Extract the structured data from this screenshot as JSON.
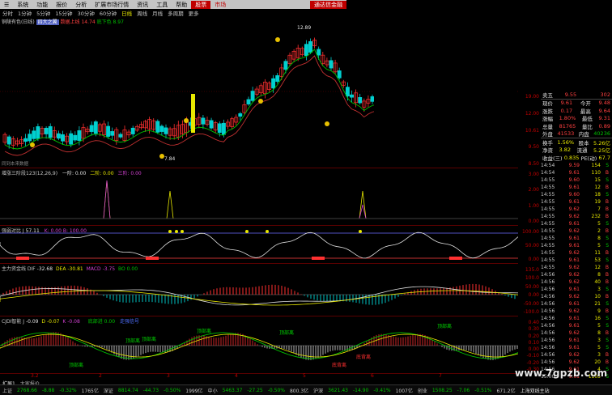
{
  "menu": {
    "items": [
      "系统",
      "功能",
      "报价",
      "分析",
      "扩展市场行情",
      "资讯",
      "工具",
      "帮助"
    ],
    "active_tab": "股票",
    "tab2": "市场",
    "right_button": "通达信金融"
  },
  "periods": [
    "分时",
    "1分钟",
    "5分钟",
    "15分钟",
    "30分钟",
    "60分钟",
    "日线",
    "周线",
    "月线",
    "多周期",
    "更多"
  ],
  "main_panel": {
    "title": "铜陵有色(日线)",
    "tag1": "四大之翼",
    "tag2": "数据上线",
    "tag2_value": "14.74",
    "tag3": "底下色",
    "tag3_value": "8.97",
    "high_label": "12.89",
    "low_label": "7.84",
    "footer_label": "同到本来数据",
    "axis": [
      "19.00",
      "12.00",
      "10.61",
      "9.50",
      "8.50"
    ]
  },
  "panel1": {
    "title": "增涨三阶段123(12,26,9)",
    "v1_label": "一阶:",
    "v1": "0.00",
    "v2_label": "二阶:",
    "v2": "0.00",
    "v3_label": "三阶:",
    "v3": "0.00",
    "axis": [
      "3.00",
      "2.00",
      "1.00",
      "0.00"
    ]
  },
  "panel2": {
    "title": "强弱对比 J",
    "value": "57.11",
    "extra": "K: 0.00 B: 100.00",
    "axis": [
      "100.00",
      "50.00",
      "0.00"
    ]
  },
  "panel3": {
    "title": "主力资金线 DIF",
    "dif": "-32.68",
    "dea_label": "DEA",
    "dea": "-30.81",
    "macd_label": "MACD",
    "macd": "-3.75",
    "bo_label": "BO",
    "bo": "0.00",
    "axis": [
      "135.0",
      "100.0",
      "50.00",
      "0.00",
      "-50.00",
      "-100.0"
    ]
  },
  "panel4": {
    "title": "CJDI智能 J",
    "j": "-0.09",
    "d_label": "D",
    "d": "-0.07",
    "k_label": "K",
    "k": "-0.08",
    "tag": "底部进",
    "tag_value": "0.00",
    "tag2": "走强信号",
    "annotations": [
      "顶部离",
      "顶部离",
      "顶部离",
      "顶部离",
      "顶部离",
      "顶部离",
      "底背离",
      "底背离"
    ],
    "axis": [
      "0.40",
      "0.30",
      "0.20",
      "0.10",
      "0.00",
      "-0.10",
      "-0.20",
      "-0.30"
    ]
  },
  "date_labels": [
    "3.2",
    "2",
    "3",
    "4",
    "5",
    "6",
    "7"
  ],
  "tabs": [
    "扩展1",
    "大家报价"
  ],
  "quote": {
    "rows": [
      {
        "l": "卖五",
        "v": "9.55",
        "r": "",
        "rv": "302"
      },
      {
        "l": "现价",
        "v": "9.61",
        "r": "今开",
        "rv": "9.48"
      },
      {
        "l": "涨跌",
        "v": "0.17",
        "r": "最高",
        "rv": "9.64"
      },
      {
        "l": "涨幅",
        "v": "1.80%",
        "r": "最低",
        "rv": "9.31"
      },
      {
        "l": "总量",
        "v": "81765",
        "r": "量比",
        "rv": "0.89"
      },
      {
        "l": "外盘",
        "v": "41533",
        "r": "内盘",
        "rv": "40236"
      },
      {
        "l": "换手",
        "v": "1.56%",
        "r": "股本",
        "rv": "5.26亿"
      },
      {
        "l": "净资",
        "v": "3.82",
        "r": "流通",
        "rv": "5.25亿"
      },
      {
        "l": "收益(三)",
        "v": "0.835",
        "r": "PE(动)",
        "rv": "67.7"
      }
    ],
    "colors": {
      "red": "#ff4040",
      "green": "#00c000",
      "yellow": "#e8e800",
      "white": "#e0e0e0"
    }
  },
  "ticks": [
    {
      "t": "14:54",
      "p": "9.59",
      "v": "154",
      "s": "S"
    },
    {
      "t": "14:54",
      "p": "9.61",
      "v": "110",
      "s": "B"
    },
    {
      "t": "14:55",
      "p": "9.60",
      "v": "15",
      "s": "S"
    },
    {
      "t": "14:55",
      "p": "9.61",
      "v": "12",
      "s": "B"
    },
    {
      "t": "14:55",
      "p": "9.60",
      "v": "18",
      "s": "S"
    },
    {
      "t": "14:55",
      "p": "9.61",
      "v": "19",
      "s": "B"
    },
    {
      "t": "14:55",
      "p": "9.62",
      "v": "7",
      "s": "B"
    },
    {
      "t": "14:55",
      "p": "9.62",
      "v": "232",
      "s": "B"
    },
    {
      "t": "14:55",
      "p": "9.61",
      "v": "5",
      "s": "S"
    },
    {
      "t": "14:55",
      "p": "9.62",
      "v": "2",
      "s": "B"
    },
    {
      "t": "14:55",
      "p": "9.61",
      "v": "8",
      "s": "S"
    },
    {
      "t": "14:55",
      "p": "9.61",
      "v": "5",
      "s": "S"
    },
    {
      "t": "14:55",
      "p": "9.62",
      "v": "11",
      "s": "B"
    },
    {
      "t": "14:55",
      "p": "9.61",
      "v": "53",
      "s": "S"
    },
    {
      "t": "14:55",
      "p": "9.62",
      "v": "12",
      "s": "B"
    },
    {
      "t": "14:56",
      "p": "9.62",
      "v": "8",
      "s": "B"
    },
    {
      "t": "14:56",
      "p": "9.62",
      "v": "40",
      "s": "B"
    },
    {
      "t": "14:56",
      "p": "9.61",
      "v": "3",
      "s": "S"
    },
    {
      "t": "14:56",
      "p": "9.62",
      "v": "10",
      "s": "B"
    },
    {
      "t": "14:56",
      "p": "9.61",
      "v": "21",
      "s": "S"
    },
    {
      "t": "14:56",
      "p": "9.62",
      "v": "9",
      "s": "B"
    },
    {
      "t": "14:56",
      "p": "9.61",
      "v": "16",
      "s": "S"
    },
    {
      "t": "14:56",
      "p": "9.61",
      "v": "5",
      "s": "S"
    },
    {
      "t": "14:56",
      "p": "9.62",
      "v": "8",
      "s": "B"
    },
    {
      "t": "14:56",
      "p": "9.61",
      "v": "3",
      "s": "S"
    },
    {
      "t": "14:56",
      "p": "9.61",
      "v": "5",
      "s": "S"
    },
    {
      "t": "14:56",
      "p": "9.62",
      "v": "3",
      "s": "B"
    },
    {
      "t": "14:56",
      "p": "9.62",
      "v": "20",
      "s": "B"
    },
    {
      "t": "14:56",
      "p": "9.61",
      "v": "4",
      "s": "S"
    },
    {
      "t": "15:00",
      "p": "9.61",
      "v": "1105",
      "s": "S"
    }
  ],
  "status": {
    "items": [
      {
        "name": "上证",
        "v": "2768.66",
        "c": "-8.88",
        "p": "-0.32%",
        "a": "1765亿",
        "up": false
      },
      {
        "name": "深证",
        "v": "8814.74",
        "c": "-44.73",
        "p": "-0.50%",
        "a": "1999亿",
        "up": false
      },
      {
        "name": "中小",
        "v": "5463.37",
        "c": "-27.25",
        "p": "-0.50%",
        "a": "800.3亿",
        "up": false
      },
      {
        "name": "沪深",
        "v": "3621.43",
        "c": "-14.90",
        "p": "-0.41%",
        "a": "1007亿",
        "up": false
      },
      {
        "name": "创业",
        "v": "1508.25",
        "c": "-7.06",
        "p": "-0.51%",
        "a": "671.2亿",
        "up": false
      }
    ],
    "server": "上海双线主站"
  },
  "watermark": "www.7gpzb.com"
}
